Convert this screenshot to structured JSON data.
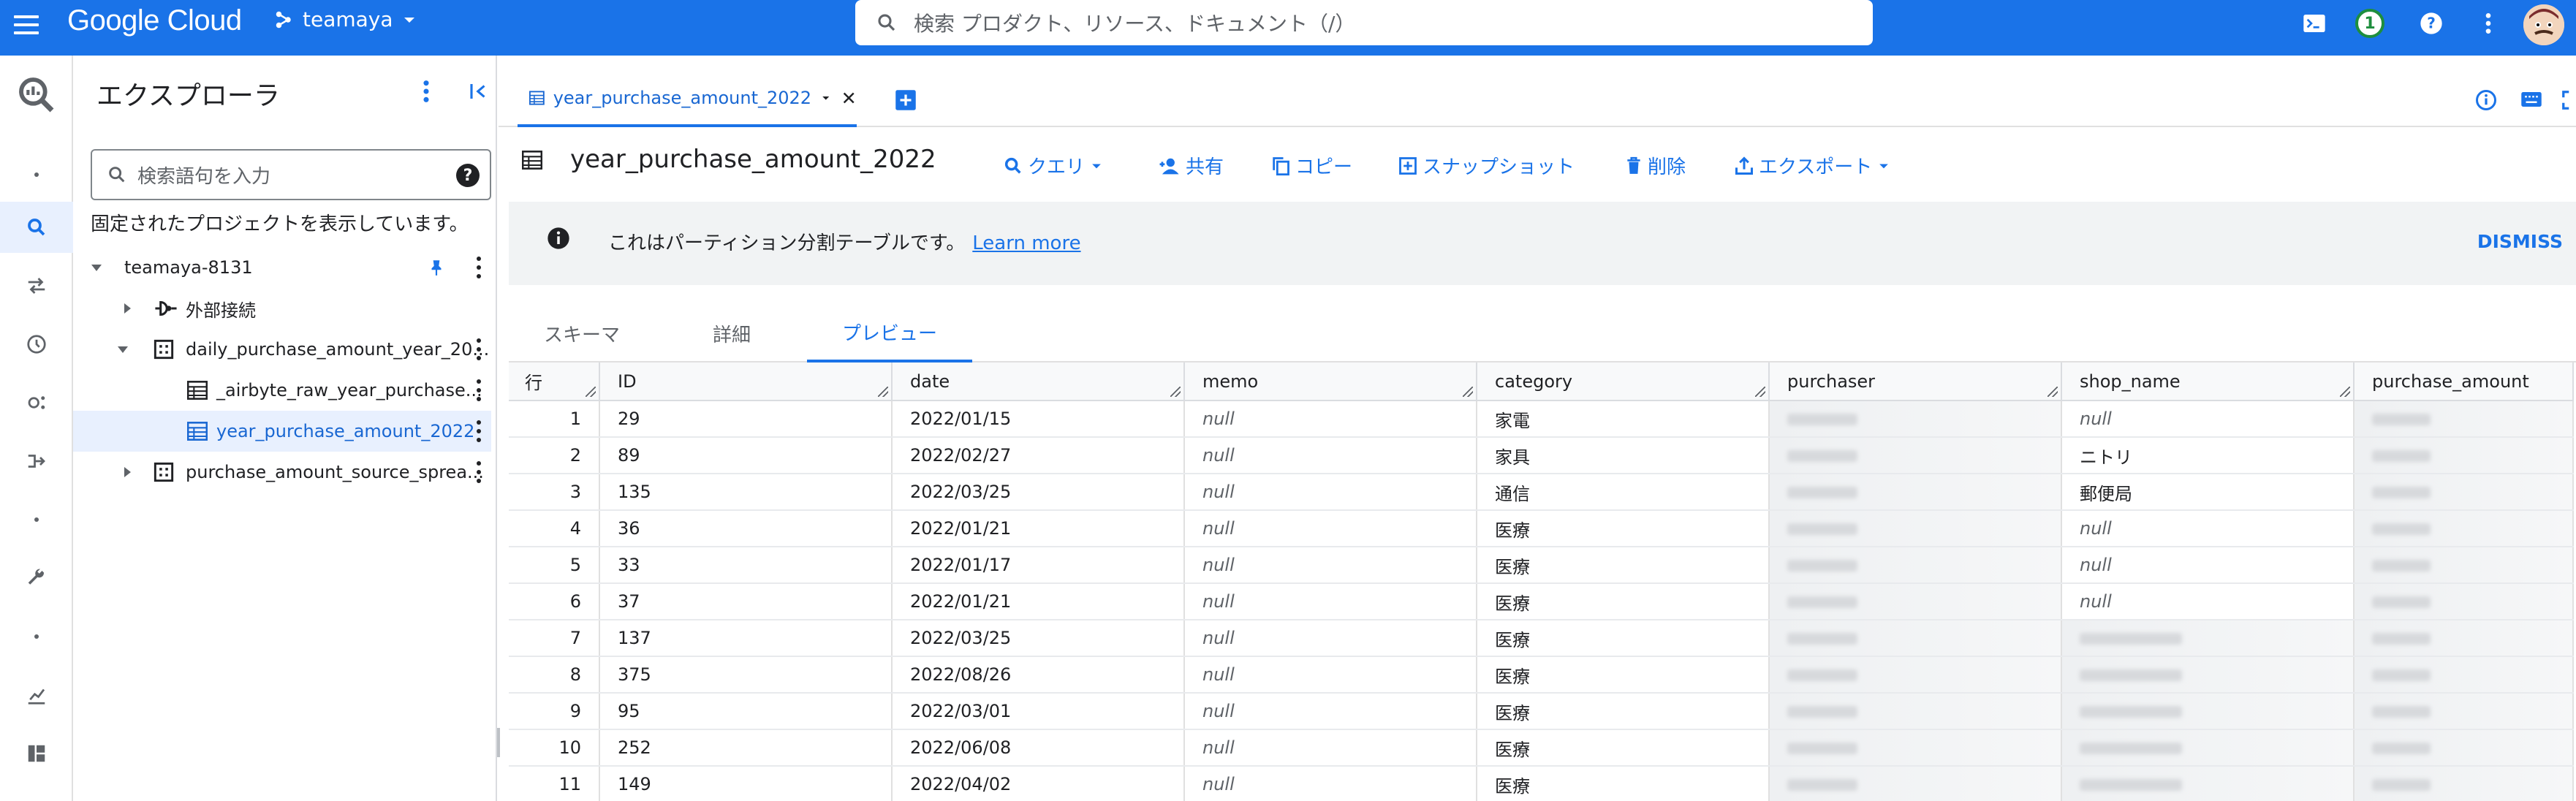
{
  "topbar": {
    "logo": "Google Cloud",
    "project": "teamaya",
    "search_placeholder": "検索  プロダクト、リソース、ドキュメント（/）",
    "notification_count": "1"
  },
  "explorer": {
    "title": "エクスプローラ",
    "search_placeholder": "検索語句を入力",
    "pinned_text": "固定されたプロジェクトを表示しています。",
    "tree": [
      {
        "label": "teamaya-8131"
      },
      {
        "label": "外部接続"
      },
      {
        "label": "daily_purchase_amount_year_20..."
      },
      {
        "label": "_airbyte_raw_year_purchase..."
      },
      {
        "label": "year_purchase_amount_2022"
      },
      {
        "label": "purchase_amount_source_sprea..."
      }
    ]
  },
  "main": {
    "tab_label": "year_purchase_amount_2022",
    "table_title": "year_purchase_amount_2022",
    "toolbar": {
      "query": "クエリ",
      "share": "共有",
      "copy": "コピー",
      "snapshot": "スナップショット",
      "delete": "削除",
      "export": "エクスポート"
    },
    "banner": {
      "text": "これはパーティション分割テーブルです。",
      "link": "Learn more",
      "dismiss": "DISMISS"
    },
    "subtabs": [
      "スキーマ",
      "詳細",
      "プレビュー"
    ],
    "columns": [
      "行",
      "ID",
      "date",
      "memo",
      "category",
      "purchaser",
      "shop_name",
      "purchase_amount"
    ],
    "rows": [
      {
        "n": "1",
        "id": "29",
        "date": "2022/01/15",
        "memo": "null",
        "category": "家電",
        "shop": "null",
        "shop_null": true
      },
      {
        "n": "2",
        "id": "89",
        "date": "2022/02/27",
        "memo": "null",
        "category": "家具",
        "shop": "ニトリ",
        "shop_null": false
      },
      {
        "n": "3",
        "id": "135",
        "date": "2022/03/25",
        "memo": "null",
        "category": "通信",
        "shop": "郵便局",
        "shop_null": false
      },
      {
        "n": "4",
        "id": "36",
        "date": "2022/01/21",
        "memo": "null",
        "category": "医療",
        "shop": "null",
        "shop_null": true
      },
      {
        "n": "5",
        "id": "33",
        "date": "2022/01/17",
        "memo": "null",
        "category": "医療",
        "shop": "null",
        "shop_null": true
      },
      {
        "n": "6",
        "id": "37",
        "date": "2022/01/21",
        "memo": "null",
        "category": "医療",
        "shop": "null",
        "shop_null": true
      },
      {
        "n": "7",
        "id": "137",
        "date": "2022/03/25",
        "memo": "null",
        "category": "医療",
        "shop": "",
        "shop_null": false
      },
      {
        "n": "8",
        "id": "375",
        "date": "2022/08/26",
        "memo": "null",
        "category": "医療",
        "shop": "",
        "shop_null": false
      },
      {
        "n": "9",
        "id": "95",
        "date": "2022/03/01",
        "memo": "null",
        "category": "医療",
        "shop": "",
        "shop_null": false
      },
      {
        "n": "10",
        "id": "252",
        "date": "2022/06/08",
        "memo": "null",
        "category": "医療",
        "shop": "",
        "shop_null": false
      },
      {
        "n": "11",
        "id": "149",
        "date": "2022/04/02",
        "memo": "null",
        "category": "医療",
        "shop": "",
        "shop_null": false
      }
    ]
  }
}
